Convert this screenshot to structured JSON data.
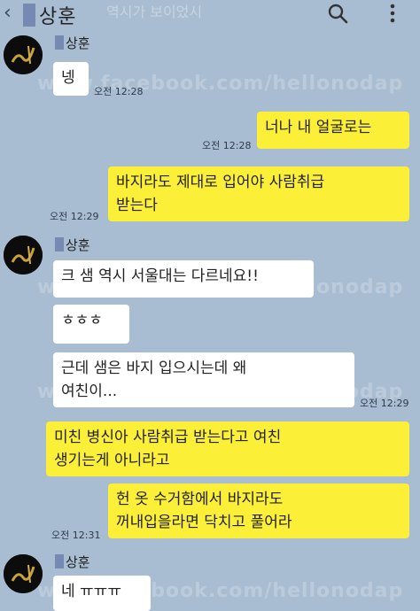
{
  "header": {
    "title": "상훈",
    "faded_text": "역시가 보이었시",
    "back_icon": "chevron-left-icon",
    "search_icon": "search-icon",
    "menu_icon": "more-vertical-icon"
  },
  "watermark": "www.facebook.com/hellonodap",
  "messages": [
    {
      "sender": "상훈",
      "text": "넹",
      "time": "오전 12:28",
      "side": "left"
    },
    {
      "text": "너나 내 얼굴로는",
      "time": "오전 12:28",
      "side": "right"
    },
    {
      "text": "바지라도 제대로 입어야 사람취급 받는다",
      "line1": "바지라도 제대로 입어야 사람취급",
      "line2": "받는다",
      "time": "오전 12:29",
      "side": "right"
    },
    {
      "sender": "상훈",
      "text": "크 샘 역시 서울대는 다르네요!!",
      "side": "left"
    },
    {
      "text": "ㅎㅎㅎ",
      "side": "left"
    },
    {
      "text": "근데 샘은 바지 입으시는데 왜 여친이...",
      "line1": "근데 샘은 바지 입으시는데 왜",
      "line2": "여친이...",
      "time": "오전 12:29",
      "side": "left"
    },
    {
      "text": "미친 병신아 사람취급 받는다고 여친 생기는게 아니라고",
      "line1": "미친 병신아 사람취급 받는다고 여친",
      "line2": "생기는게 아니라고",
      "side": "right"
    },
    {
      "text": "헌 옷 수거함에서 바지라도 꺼내입을라면 닥치고 풀어라",
      "line1": "헌 옷 수거함에서 바지라도",
      "line2": "꺼내입을라면 닥치고 풀어라",
      "time": "오전 12:31",
      "side": "right"
    },
    {
      "sender": "상훈",
      "text": "네 ㅠㅠㅠ",
      "side": "left"
    }
  ],
  "colors": {
    "background": "#a9bdd2",
    "bubble_yellow": "#fcef38",
    "bubble_white": "#ffffff"
  }
}
